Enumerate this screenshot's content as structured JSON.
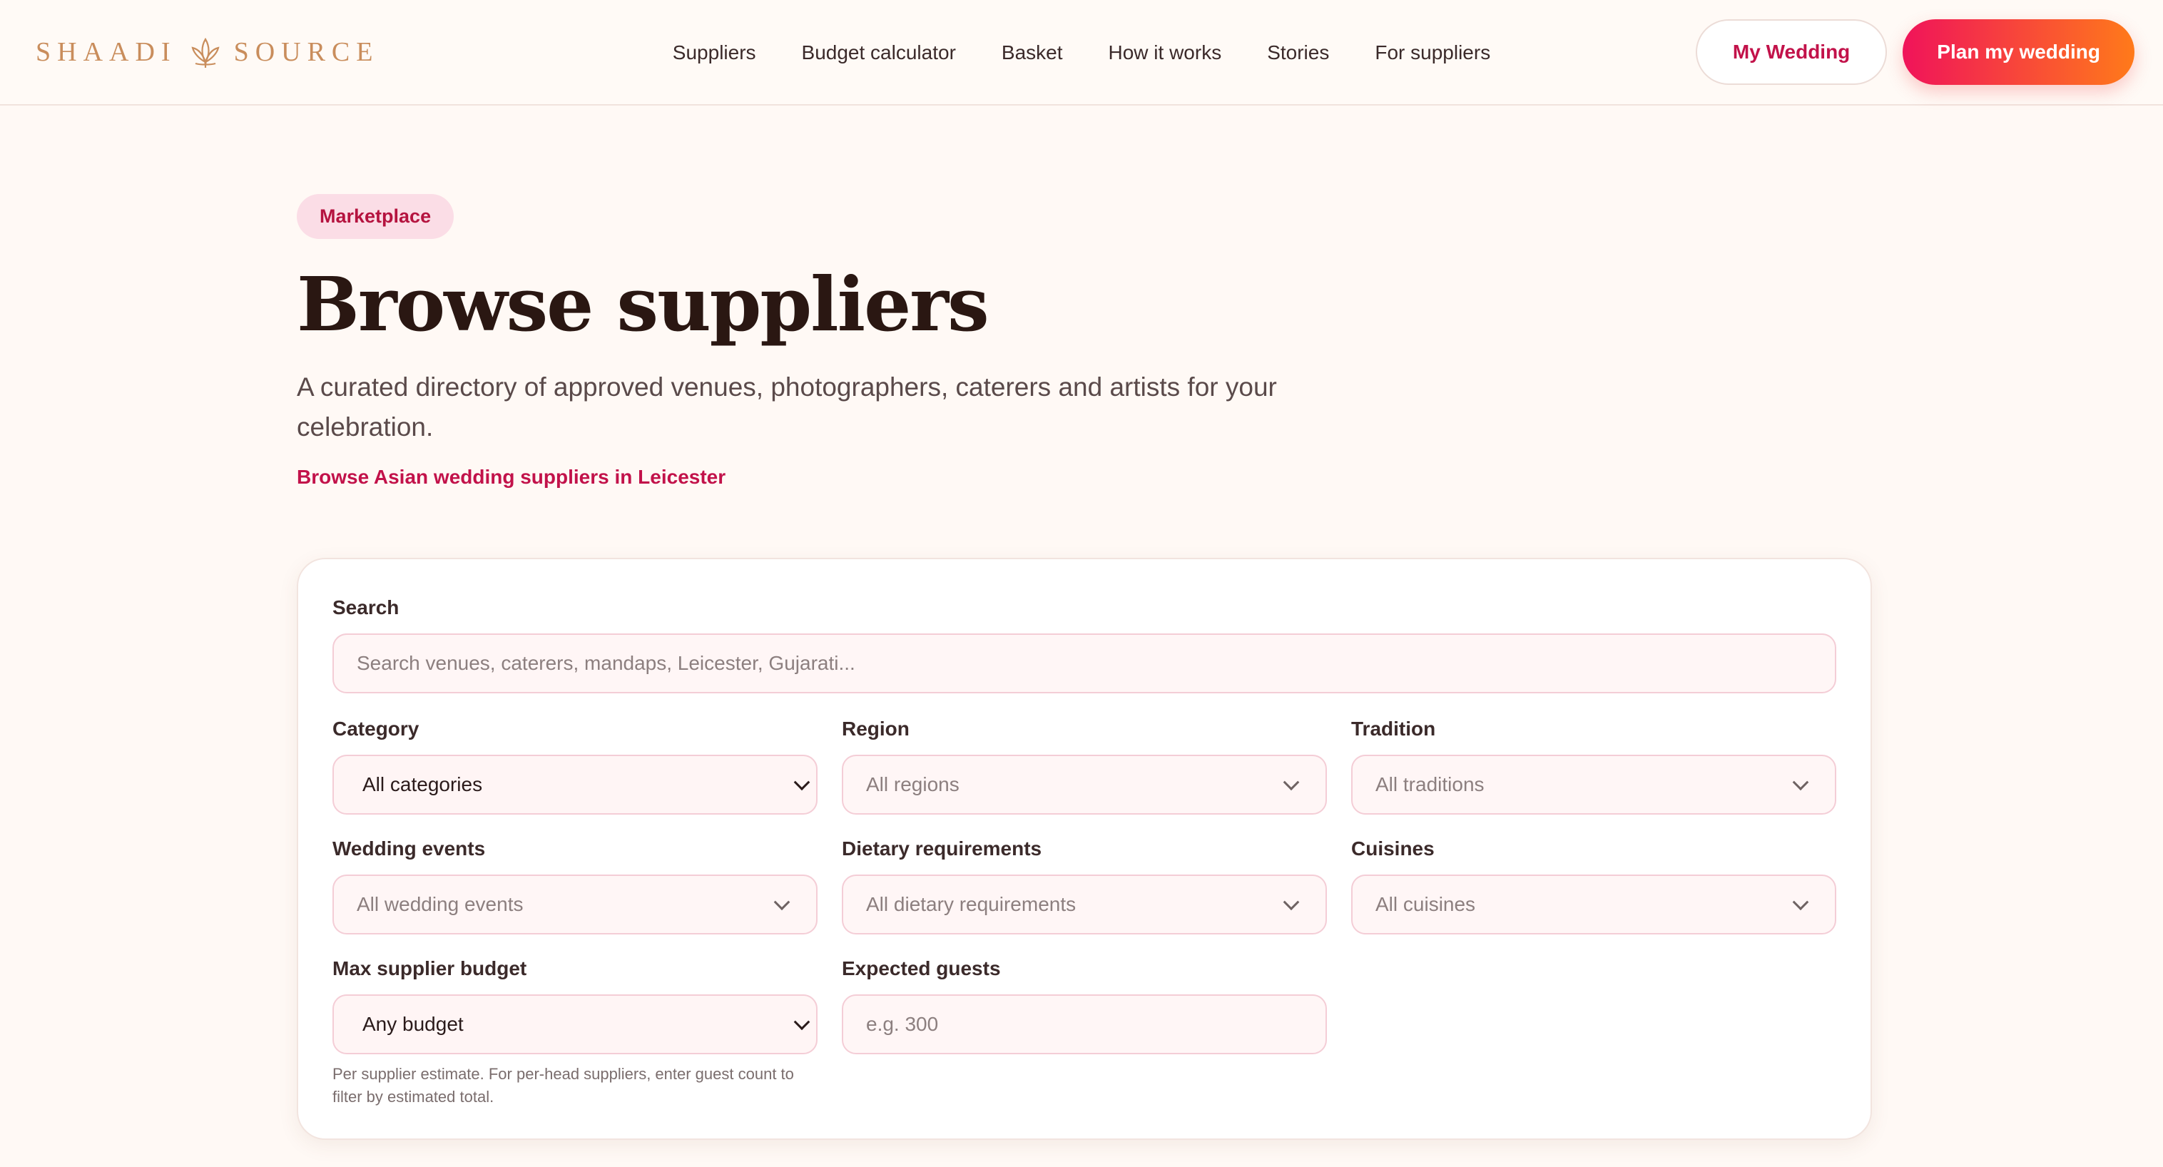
{
  "brand": {
    "name_left": "SHAADI",
    "name_right": "SOURCE"
  },
  "nav": [
    "Suppliers",
    "Budget calculator",
    "Basket",
    "How it works",
    "Stories",
    "For suppliers"
  ],
  "header_actions": {
    "my_wedding": "My Wedding",
    "plan": "Plan my wedding"
  },
  "hero": {
    "badge": "Marketplace",
    "title": "Browse suppliers",
    "subtitle": "A curated directory of approved venues, photographers, caterers and artists for your celebration.",
    "link": "Browse Asian wedding suppliers in Leicester"
  },
  "filters": {
    "search": {
      "label": "Search",
      "placeholder": "Search venues, caterers, mandaps, Leicester, Gujarati..."
    },
    "category": {
      "label": "Category",
      "value": "All categories"
    },
    "region": {
      "label": "Region",
      "value": "All regions"
    },
    "tradition": {
      "label": "Tradition",
      "value": "All traditions"
    },
    "wedding_events": {
      "label": "Wedding events",
      "value": "All wedding events"
    },
    "dietary": {
      "label": "Dietary requirements",
      "value": "All dietary requirements"
    },
    "cuisines": {
      "label": "Cuisines",
      "value": "All cuisines"
    },
    "budget": {
      "label": "Max supplier budget",
      "value": "Any budget",
      "help": "Per supplier estimate. For per-head suppliers, enter guest count to filter by estimated total."
    },
    "guests": {
      "label": "Expected guests",
      "placeholder": "e.g. 300"
    }
  },
  "colors": {
    "accent": "#c2124a",
    "gradient_start": "#f0135a",
    "gradient_end": "#ff7a1a",
    "background": "#fff9f5",
    "logo": "#c98d5c"
  }
}
